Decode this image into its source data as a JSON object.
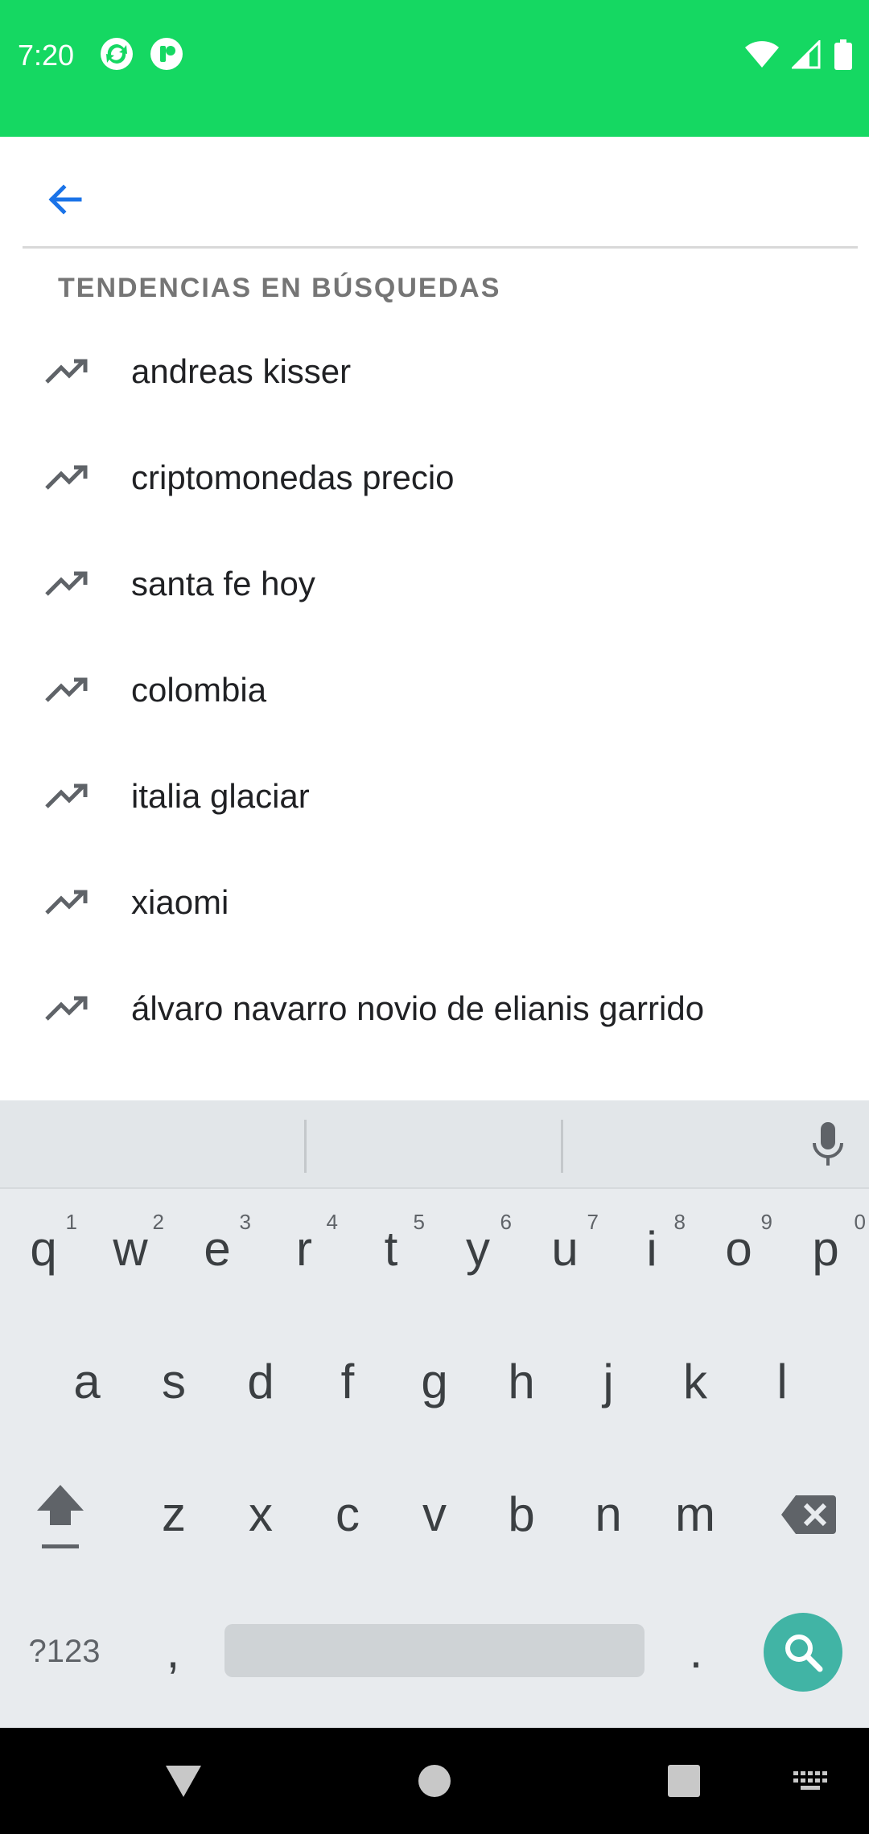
{
  "status_bar": {
    "time": "7:20",
    "left_icons": [
      "sync-icon",
      "app-icon"
    ],
    "right_icons": [
      "wifi-icon",
      "signal-icon",
      "battery-icon"
    ],
    "background_color": "#15d862"
  },
  "search": {
    "back_icon": "arrow-left-icon",
    "query": "",
    "placeholder": ""
  },
  "trending": {
    "title": "TENDENCIAS EN BÚSQUEDAS",
    "items": [
      {
        "label": "andreas kisser",
        "icon": "trending-up-icon"
      },
      {
        "label": "criptomonedas precio",
        "icon": "trending-up-icon"
      },
      {
        "label": "santa fe hoy",
        "icon": "trending-up-icon"
      },
      {
        "label": "colombia",
        "icon": "trending-up-icon"
      },
      {
        "label": "italia glaciar",
        "icon": "trending-up-icon"
      },
      {
        "label": "xiaomi",
        "icon": "trending-up-icon"
      },
      {
        "label": "álvaro navarro novio de elianis garrido",
        "icon": "trending-up-icon"
      }
    ]
  },
  "keyboard": {
    "row1": [
      {
        "key": "q",
        "hint": "1"
      },
      {
        "key": "w",
        "hint": "2"
      },
      {
        "key": "e",
        "hint": "3"
      },
      {
        "key": "r",
        "hint": "4"
      },
      {
        "key": "t",
        "hint": "5"
      },
      {
        "key": "y",
        "hint": "6"
      },
      {
        "key": "u",
        "hint": "7"
      },
      {
        "key": "i",
        "hint": "8"
      },
      {
        "key": "o",
        "hint": "9"
      },
      {
        "key": "p",
        "hint": "0"
      }
    ],
    "row2": [
      "a",
      "s",
      "d",
      "f",
      "g",
      "h",
      "j",
      "k",
      "l"
    ],
    "row3": [
      "z",
      "x",
      "c",
      "v",
      "b",
      "n",
      "m"
    ],
    "symbols_label": "?123",
    "comma": ",",
    "period": ".",
    "accent_color": "#41b4a5"
  },
  "nav_bar": {
    "buttons": [
      "back-triangle-icon",
      "home-circle-icon",
      "recents-square-icon",
      "keyboard-icon"
    ]
  }
}
